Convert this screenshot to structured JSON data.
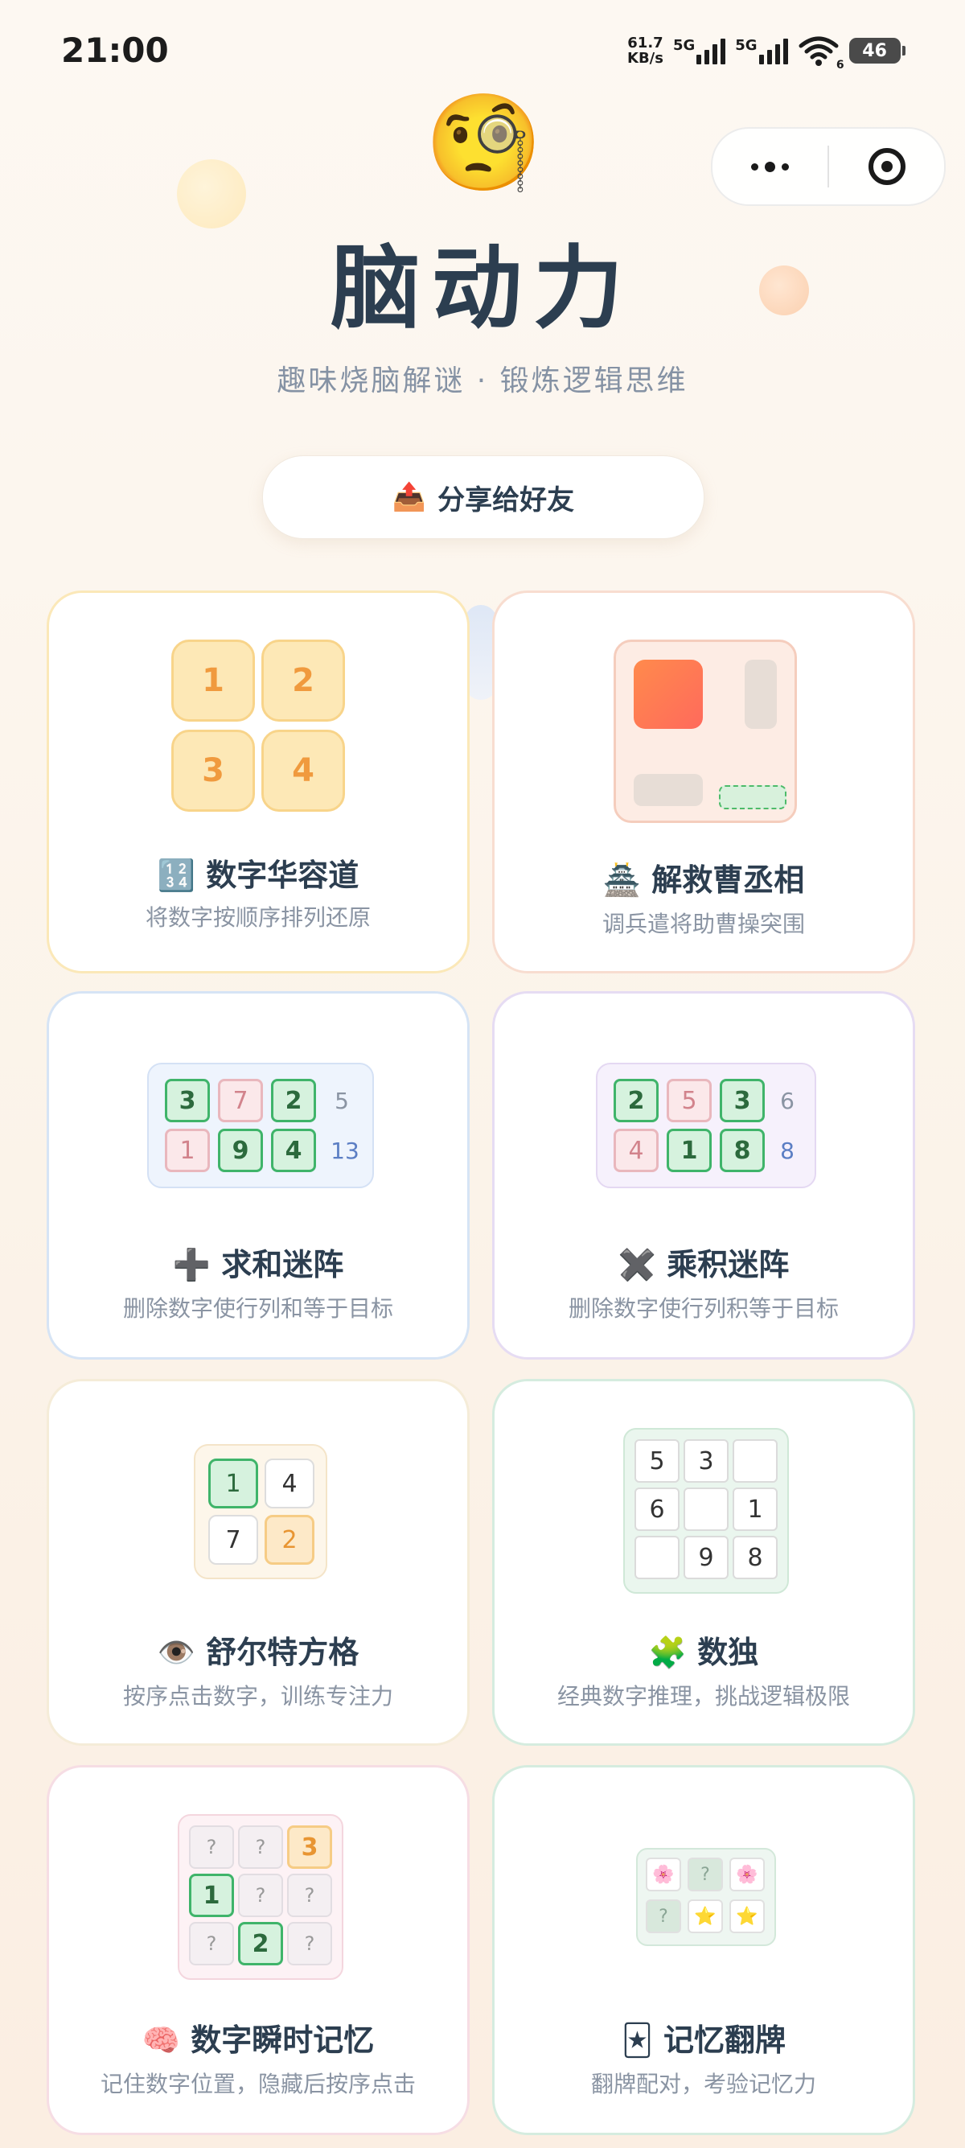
{
  "status_bar": {
    "time": "21:00",
    "net_speed_value": "61.7",
    "net_speed_unit": "KB/s",
    "sim1": "5G",
    "sim2": "5G",
    "wifi_badge": "6",
    "battery": "46"
  },
  "app": {
    "emoji": "🧐",
    "title": "脑动力",
    "subtitle": "趣味烧脑解谜 · 锻炼逻辑思维",
    "share_icon": "📤",
    "share_label": "分享给好友"
  },
  "games": [
    {
      "emoji": "🔢",
      "name": "数字华容道",
      "desc": "将数字按顺序排列还原",
      "tiles": [
        "1",
        "2",
        "3",
        "4"
      ]
    },
    {
      "emoji": "🏯",
      "name": "解救曹丞相",
      "desc": "调兵遣将助曹操突围"
    },
    {
      "emoji": "➕",
      "name": "求和迷阵",
      "desc": "删除数字使行列和等于目标",
      "grid": [
        [
          "3",
          "7",
          "2"
        ],
        [
          "1",
          "9",
          "4"
        ]
      ],
      "totals": [
        "5",
        "13"
      ]
    },
    {
      "emoji": "✖️",
      "name": "乘积迷阵",
      "desc": "删除数字使行列积等于目标",
      "grid": [
        [
          "2",
          "5",
          "3"
        ],
        [
          "4",
          "1",
          "8"
        ]
      ],
      "totals": [
        "6",
        "8"
      ]
    },
    {
      "emoji": "👁️",
      "name": "舒尔特方格",
      "desc": "按序点击数字，训练专注力",
      "grid": [
        [
          "1",
          "4"
        ],
        [
          "7",
          "2"
        ]
      ]
    },
    {
      "emoji": "🧩",
      "name": "数独",
      "desc": "经典数字推理，挑战逻辑极限",
      "grid": [
        [
          "5",
          "3",
          ""
        ],
        [
          "6",
          "",
          "1"
        ],
        [
          "",
          "9",
          "8"
        ]
      ]
    },
    {
      "emoji": "🧠",
      "name": "数字瞬时记忆",
      "desc": "记住数字位置，隐藏后按序点击",
      "grid": [
        [
          "?",
          "?",
          "3"
        ],
        [
          "1",
          "?",
          "?"
        ],
        [
          "?",
          "2",
          "?"
        ]
      ]
    },
    {
      "emoji": "🃏",
      "name": "记忆翻牌",
      "desc": "翻牌配对，考验记忆力",
      "grid": [
        [
          "🌸",
          "?",
          "🌸"
        ],
        [
          "?",
          "⭐",
          "⭐"
        ]
      ]
    }
  ]
}
